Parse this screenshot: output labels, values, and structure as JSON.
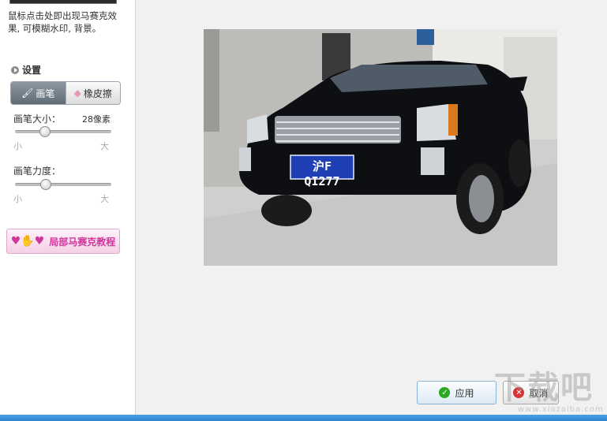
{
  "sidebar": {
    "hint_text": "鼠标点击处即出现马赛克效果, 可模糊水印, 背景。",
    "settings_title": "设置",
    "tools": {
      "brush_label": "画笔",
      "eraser_label": "橡皮擦"
    },
    "brush_size": {
      "label": "画笔大小：",
      "value": "28像素",
      "min_label": "小",
      "max_label": "大",
      "level": 0.28
    },
    "brush_strength": {
      "label": "画笔力度：",
      "min_label": "小",
      "max_label": "大",
      "level": 0.29
    },
    "tutorial_label": "局部马赛克教程"
  },
  "canvas": {
    "plate_text": "沪F QI277"
  },
  "actions": {
    "apply_label": "应用",
    "cancel_label": "取消"
  },
  "watermark": {
    "main": "下载吧",
    "sub": "www.xiazaiba.com"
  },
  "colors": {
    "accent": "#2f84cf",
    "tab_active": "#6d7983",
    "tutorial_text": "#d1379a"
  }
}
